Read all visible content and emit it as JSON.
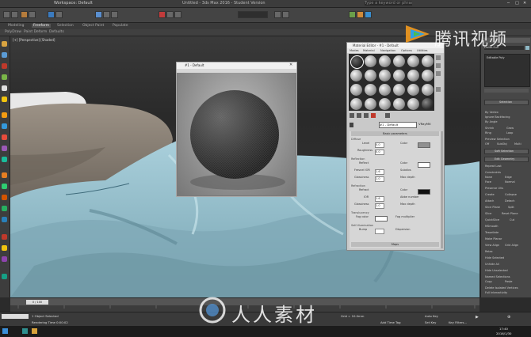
{
  "app": {
    "window_title": "Untitled - 3ds Max 2016 - Student Version",
    "workspace": "Workspace: Default",
    "search_placeholder": "Type a keyword or phrase"
  },
  "main_tabs": [
    "Modeling",
    "Freeform",
    "Selection",
    "Object Paint",
    "Populate"
  ],
  "ribbon_items": [
    "PolyDraw",
    "Paint Deform",
    "Defaults"
  ],
  "viewport": {
    "label": "[+] [Perspective] [Shaded]"
  },
  "preview_window": {
    "title": "#1 - Default"
  },
  "material_editor": {
    "title": "Material Editor - #1 - Default",
    "menu": [
      "Modes",
      "Material",
      "Navigation",
      "Options",
      "Utilities"
    ],
    "material_name": "#1 - Default",
    "material_type": "VRayMtl",
    "rollout_title": "Basic parameters",
    "sections": {
      "diffuse": "Diffuse",
      "reflection": "Reflection",
      "refraction": "Refraction",
      "translucency": "Translucency",
      "self_illum": "Self-illumination"
    },
    "params": [
      {
        "label": "Level",
        "value": "0.0",
        "extra": "Color"
      },
      {
        "label": "Roughness",
        "value": "0.0",
        "extra": ""
      },
      {
        "label": "Reflect",
        "value": "",
        "extra": "Color"
      },
      {
        "label": "Fresnel IOR",
        "value": "1.6",
        "extra": "Subdivs"
      },
      {
        "label": "Glossiness",
        "value": "1.0",
        "extra": "Max depth"
      },
      {
        "label": "Refract",
        "value": "",
        "extra": "Color"
      },
      {
        "label": "IOR",
        "value": "1.6",
        "extra": "Abbe number"
      },
      {
        "label": "Glossiness",
        "value": "1.0",
        "extra": "Max depth"
      },
      {
        "label": "Fog color",
        "value": "",
        "extra": "Fog multiplier"
      },
      {
        "label": "Bump",
        "value": "",
        "extra": "Dispersion"
      }
    ],
    "footer": "Maps"
  },
  "right_panel": {
    "object_name": "Dollar-Sun",
    "modifier": "Editable Poly",
    "items": [
      "Selection",
      "By Vertex",
      "Ignore Backfacing",
      "By Angle",
      "Shrink",
      "Grow",
      "Ring",
      "Loop",
      "Preview Selection",
      "Off",
      "SubObj",
      "Multi",
      "Soft Selection",
      "Edit Geometry",
      "Repeat Last",
      "Constraints",
      "None",
      "Edge",
      "Face",
      "Normal",
      "Preserve UVs",
      "Create",
      "Collapse",
      "Attach",
      "Detach",
      "Slice Plane",
      "Split",
      "Slice",
      "Reset Plane",
      "QuickSlice",
      "Cut",
      "MSmooth",
      "Tessellate",
      "Make Planar",
      "View Align",
      "Grid Align",
      "Relax",
      "Hide Selected",
      "Unhide All",
      "Hide Unselected",
      "Named Selections",
      "Copy",
      "Paste",
      "Delete Isolated Vertices",
      "Full Interactivity"
    ]
  },
  "timeline": {
    "frame": "0 / 100"
  },
  "status": {
    "selection": "1 Object Selected",
    "prompt": "Rendering Time  0:00:02",
    "grid": "Grid = 10.0mm",
    "add_time_tag": "Add Time Tag",
    "auto_key": "Auto Key",
    "set_key": "Set Key",
    "key_filters": "Key Filters..."
  },
  "taskbar": {
    "time": "17:40",
    "date": "2016/1/30"
  },
  "watermarks": {
    "tencent": "腾讯视频",
    "renren": "人人素材"
  },
  "colors": {
    "viewport_bg": "#2d2d2d",
    "cloth": "#8fb9c6",
    "pillow": "#8c8378",
    "panel": "#474747",
    "editor_bg": "#c9c9c9"
  }
}
